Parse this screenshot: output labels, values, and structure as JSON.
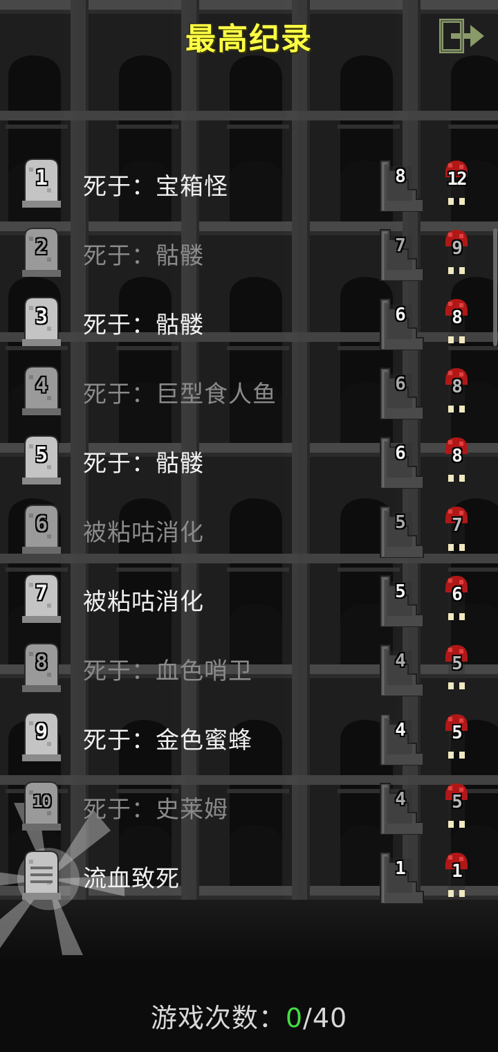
{
  "title": "最高纪录",
  "exit_icon": "exit-icon",
  "records": [
    {
      "rank": "1",
      "cause": "死于：宝箱怪",
      "depth": "8",
      "level": "12",
      "dim": false
    },
    {
      "rank": "2",
      "cause": "死于：骷髅",
      "depth": "7",
      "level": "9",
      "dim": true
    },
    {
      "rank": "3",
      "cause": "死于：骷髅",
      "depth": "6",
      "level": "8",
      "dim": false
    },
    {
      "rank": "4",
      "cause": "死于：巨型食人鱼",
      "depth": "6",
      "level": "8",
      "dim": true
    },
    {
      "rank": "5",
      "cause": "死于：骷髅",
      "depth": "6",
      "level": "8",
      "dim": false
    },
    {
      "rank": "6",
      "cause": "被粘咕消化",
      "depth": "5",
      "level": "7",
      "dim": true
    },
    {
      "rank": "7",
      "cause": "被粘咕消化",
      "depth": "5",
      "level": "6",
      "dim": false
    },
    {
      "rank": "8",
      "cause": "死于：血色哨卫",
      "depth": "4",
      "level": "5",
      "dim": true
    },
    {
      "rank": "9",
      "cause": "死于：金色蜜蜂",
      "depth": "4",
      "level": "5",
      "dim": false
    },
    {
      "rank": "10",
      "cause": "死于：史莱姆",
      "depth": "4",
      "level": "5",
      "dim": true
    },
    {
      "rank": "",
      "cause": "流血致死",
      "depth": "1",
      "level": "1",
      "dim": false
    }
  ],
  "footer": {
    "label": "游戏次数：",
    "current": "0",
    "total": "/40"
  },
  "colors": {
    "title": "#ffff44",
    "highlight": "#44dd44",
    "blood": "#b01818"
  }
}
